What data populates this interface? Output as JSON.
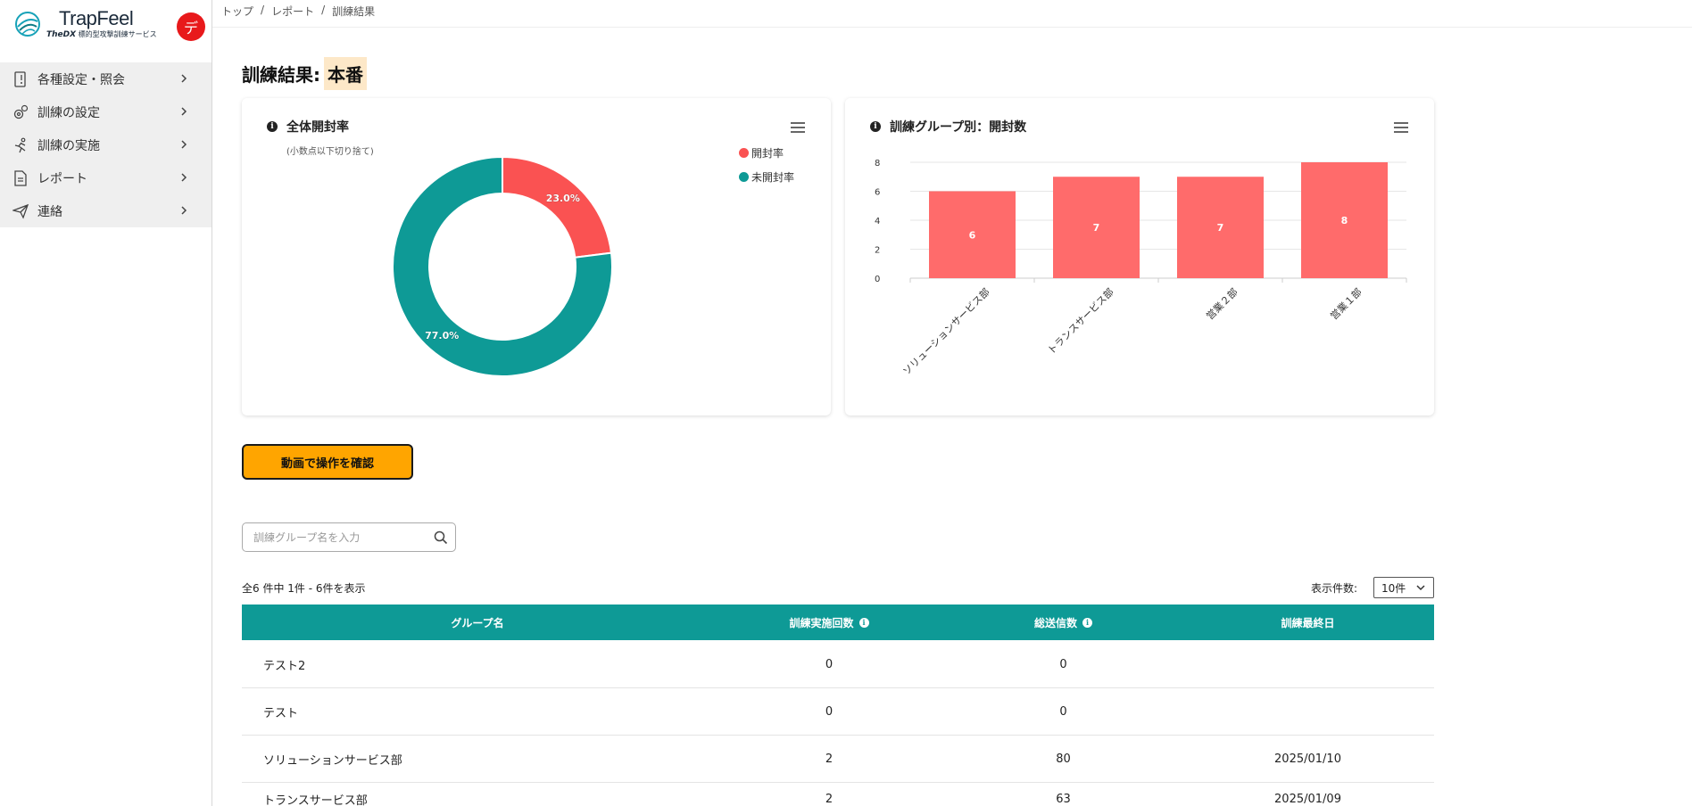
{
  "brand": {
    "name": "TrapFeel",
    "sub_prefix": "TheDX",
    "sub_text": "標的型攻撃訓練サービス"
  },
  "user": {
    "avatar_initial": "デ"
  },
  "sidebar": {
    "items": [
      {
        "label": "各種設定・照会",
        "icon": "settings-doc-icon"
      },
      {
        "label": "訓練の設定",
        "icon": "gears-icon"
      },
      {
        "label": "訓練の実施",
        "icon": "running-person-icon"
      },
      {
        "label": "レポート",
        "icon": "report-doc-icon"
      },
      {
        "label": "連絡",
        "icon": "paper-plane-icon"
      }
    ]
  },
  "breadcrumb": {
    "items": [
      "トップ",
      "レポート",
      "訓練結果"
    ],
    "separator": "/"
  },
  "page": {
    "title_prefix": "訓練結果:",
    "title_highlight": "本番"
  },
  "donut_card": {
    "title": "全体開封率",
    "note": "(小数点以下切り捨て)"
  },
  "bar_card": {
    "title": "訓練グループ別：開封数"
  },
  "chart_data": [
    {
      "type": "pie",
      "title": "全体開封率",
      "categories": [
        "開封率",
        "未開封率"
      ],
      "values": [
        23.0,
        77.0
      ],
      "labels": [
        "23.0%",
        "77.0%"
      ],
      "colors": [
        "#fa5252",
        "#0e9a96"
      ],
      "legend": "top-right"
    },
    {
      "type": "bar",
      "title": "訓練グループ別：開封数",
      "categories": [
        "ソリューションサービス部",
        "トランスサービス部",
        "営業２部",
        "営業１部"
      ],
      "values": [
        6,
        7,
        7,
        8
      ],
      "ylim": [
        0,
        8
      ],
      "yticks": [
        "0",
        "2",
        "4",
        "6",
        "8"
      ],
      "color": "#ff6b6b",
      "grid": true
    }
  ],
  "video_button": {
    "label": "動画で操作を確認"
  },
  "search": {
    "placeholder": "訓練グループ名を入力",
    "value": ""
  },
  "pagination": {
    "summary": "全6 件中 1件 - 6件を表示",
    "per_page_label": "表示件数:",
    "per_page_value": "10件"
  },
  "table": {
    "headers": [
      "グループ名",
      "訓練実施回数",
      "総送信数",
      "訓練最終日"
    ],
    "rows": [
      [
        "テスト2",
        "0",
        "0",
        ""
      ],
      [
        "テスト",
        "0",
        "0",
        ""
      ],
      [
        "ソリューションサービス部",
        "2",
        "80",
        "2025/01/10"
      ],
      [
        "トランスサービス部",
        "2",
        "63",
        "2025/01/09"
      ]
    ]
  },
  "colors": {
    "accent_teal": "#0e9a96",
    "accent_red": "#fa5252",
    "bar_red": "#ff6b6b",
    "button_orange": "#ffa500",
    "avatar_red": "#e8191b"
  }
}
